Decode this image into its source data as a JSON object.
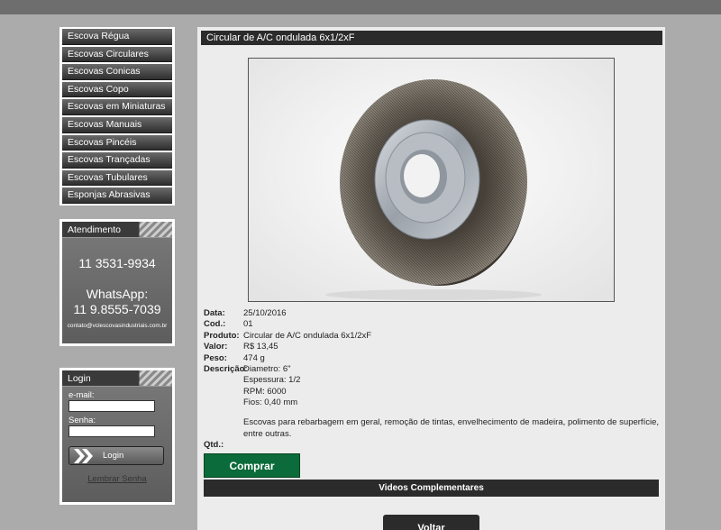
{
  "menu": {
    "items": [
      {
        "label": "Escova Régua"
      },
      {
        "label": "Escovas Circulares"
      },
      {
        "label": "Escovas Conicas"
      },
      {
        "label": "Escovas Copo"
      },
      {
        "label": "Escovas em Miniaturas"
      },
      {
        "label": "Escovas Manuais"
      },
      {
        "label": "Escovas Pincéis"
      },
      {
        "label": "Escovas Trançadas"
      },
      {
        "label": "Escovas Tubulares"
      },
      {
        "label": "Esponjas Abrasivas"
      }
    ]
  },
  "atendimento": {
    "title": "Atendimento",
    "phone": "11 3531-9934",
    "whatsapp_label": "WhatsApp:",
    "whatsapp_number": "11 9.8555-7039",
    "email": "contato@vclescovasindustriais.com.br"
  },
  "login": {
    "title": "Login",
    "email_label": "e-mail:",
    "email_value": "",
    "password_label": "Senha:",
    "password_value": "",
    "button_label": "Login",
    "forgot_label": "Lembrar Senha"
  },
  "product": {
    "title": "Circular de A/C ondulada 6x1/2xF",
    "labels": {
      "data": "Data:",
      "cod": "Cod.:",
      "produto": "Produto:",
      "valor": "Valor:",
      "peso": "Peso:",
      "descricao": "Descrição:",
      "qtd": "Qtd.:"
    },
    "data": "25/10/2016",
    "cod": "01",
    "produto": "Circular de A/C ondulada 6x1/2xF",
    "valor": "R$ 13,45",
    "peso": "474 g",
    "descricao_lines": [
      "Diametro: 6\"",
      "Espessura: 1/2",
      "RPM: 6000",
      "Fios: 0,40 mm"
    ],
    "descricao_text": "Escovas para rebarbagem em geral, remoção de tintas, envelhecimento de madeira, polimento de superfície, entre outras.",
    "qtd": ""
  },
  "actions": {
    "buy_label": "Comprar",
    "videos_label": "Videos Complementares",
    "back_label": "Voltar"
  },
  "colors": {
    "background": "#ababab",
    "topbar": "#6e6e6e",
    "panel": "#ececec",
    "dark_bar": "#2b2b2b",
    "buy_green": "#0b6b3a"
  }
}
